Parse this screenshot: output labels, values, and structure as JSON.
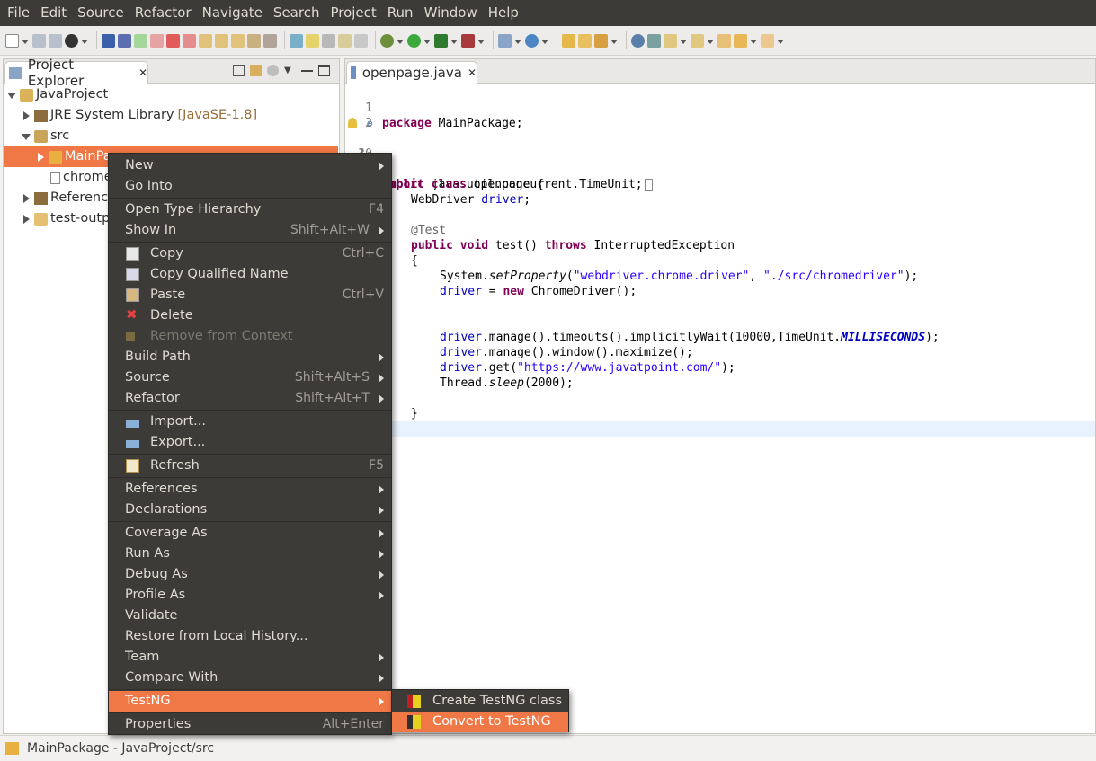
{
  "menubar": [
    "File",
    "Edit",
    "Source",
    "Refactor",
    "Navigate",
    "Search",
    "Project",
    "Run",
    "Window",
    "Help"
  ],
  "explorer": {
    "tab_label": "Project Explorer",
    "tree": [
      {
        "label": "JavaProject",
        "suffix": ""
      },
      {
        "label": "JRE System Library",
        "suffix": "[JavaSE-1.8]"
      },
      {
        "label": "src",
        "suffix": ""
      },
      {
        "label": "MainPac",
        "suffix": ""
      },
      {
        "label": "chrome",
        "suffix": ""
      },
      {
        "label": "Reference",
        "suffix": ""
      },
      {
        "label": "test-outpu",
        "suffix": ""
      }
    ]
  },
  "editor": {
    "tab_label": "openpage.java",
    "line_numbers": [
      "1",
      "2",
      "3",
      "10",
      "11"
    ],
    "code": {
      "l1_kw": "package",
      "l1_rest": " MainPackage;",
      "l3_kw": "import",
      "l3_rest": " java.util.concurrent.TimeUnit;",
      "l11_kw1": "public",
      "l11_kw2": "class",
      "l11_rest": " openpage {",
      "driver_type": "WebDriver",
      "driver_field": "driver",
      "semicolon": ";",
      "annotation": "@Test",
      "test_kw1": "public",
      "test_kw2": "void",
      "test_sig": " test() ",
      "test_kw3": "throws",
      "test_exc": " InterruptedException",
      "brace_open": "{",
      "sp_prefix": "System.",
      "sp_method": "setProperty",
      "sp_open": "(",
      "sp_str1": "\"webdriver.chrome.driver\"",
      "sp_comma": ", ",
      "sp_str2": "\"./src/chromedriver\"",
      "sp_close": ");",
      "new_field": "driver",
      "new_eq": " = ",
      "new_kw": "new",
      "new_rest": " ChromeDriver();",
      "wait_field": "driver",
      "wait_rest": ".manage().timeouts().implicitlyWait(10000,TimeUnit.",
      "wait_const": "MILLISECONDS",
      "wait_end": ");",
      "max_field": "driver",
      "max_rest": ".manage().window().maximize();",
      "get_field": "driver",
      "get_open": ".get(",
      "get_str": "\"https://www.javatpoint.com/\"",
      "get_close": ");",
      "sleep_prefix": "Thread.",
      "sleep_method": "sleep",
      "sleep_rest": "(2000);",
      "brace_close": "}"
    }
  },
  "context_menu": {
    "items": [
      {
        "label": "New",
        "accel": "",
        "submenu": true
      },
      {
        "label": "Go Into",
        "accel": "",
        "submenu": false
      },
      {
        "label": "Open Type Hierarchy",
        "accel": "F4",
        "submenu": false
      },
      {
        "label": "Show In",
        "accel": "Shift+Alt+W",
        "submenu": true
      },
      {
        "label": "Copy",
        "accel": "Ctrl+C",
        "submenu": false
      },
      {
        "label": "Copy Qualified Name",
        "accel": "",
        "submenu": false
      },
      {
        "label": "Paste",
        "accel": "Ctrl+V",
        "submenu": false
      },
      {
        "label": "Delete",
        "accel": "",
        "submenu": false
      },
      {
        "label": "Remove from Context",
        "accel": "",
        "submenu": false,
        "disabled": true
      },
      {
        "label": "Build Path",
        "accel": "",
        "submenu": true
      },
      {
        "label": "Source",
        "accel": "Shift+Alt+S",
        "submenu": true
      },
      {
        "label": "Refactor",
        "accel": "Shift+Alt+T",
        "submenu": true
      },
      {
        "label": "Import...",
        "accel": "",
        "submenu": false
      },
      {
        "label": "Export...",
        "accel": "",
        "submenu": false
      },
      {
        "label": "Refresh",
        "accel": "F5",
        "submenu": false
      },
      {
        "label": "References",
        "accel": "",
        "submenu": true
      },
      {
        "label": "Declarations",
        "accel": "",
        "submenu": true
      },
      {
        "label": "Coverage As",
        "accel": "",
        "submenu": true
      },
      {
        "label": "Run As",
        "accel": "",
        "submenu": true
      },
      {
        "label": "Debug As",
        "accel": "",
        "submenu": true
      },
      {
        "label": "Profile As",
        "accel": "",
        "submenu": true
      },
      {
        "label": "Validate",
        "accel": "",
        "submenu": false
      },
      {
        "label": "Restore from Local History...",
        "accel": "",
        "submenu": false
      },
      {
        "label": "Team",
        "accel": "",
        "submenu": true
      },
      {
        "label": "Compare With",
        "accel": "",
        "submenu": true
      },
      {
        "label": "TestNG",
        "accel": "",
        "submenu": true,
        "selected": true
      },
      {
        "label": "Properties",
        "accel": "Alt+Enter",
        "submenu": false
      }
    ]
  },
  "testng_submenu": {
    "items": [
      {
        "label": "Create TestNG class"
      },
      {
        "label": "Convert to TestNG",
        "selected": true
      }
    ]
  },
  "status": {
    "text": "MainPackage - JavaProject/src"
  },
  "colors": {
    "menu_bg": "#3c3b37",
    "selection": "#f07746",
    "keyword": "#7f0055",
    "string": "#2a00ff",
    "field": "#0000c0"
  },
  "icons": [
    "new-wizard-icon",
    "save-icon",
    "save-all-icon",
    "run-icon",
    "debug-icon",
    "package-icon",
    "folder-icon",
    "library-icon",
    "copy-icon",
    "paste-icon",
    "delete-icon",
    "import-icon",
    "export-icon",
    "refresh-icon",
    "testng-icon"
  ]
}
